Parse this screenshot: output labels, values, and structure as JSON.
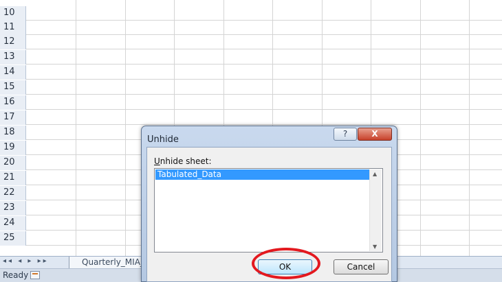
{
  "grid": {
    "rows": [
      "10",
      "11",
      "12",
      "13",
      "14",
      "15",
      "16",
      "17",
      "18",
      "19",
      "20",
      "21",
      "22",
      "23",
      "24",
      "25"
    ]
  },
  "tabbar": {
    "nav_icons": "first-prev-next-last-sheet-icons",
    "sheet_tab": "Quarterly_MIA_Da"
  },
  "status": {
    "ready": "Ready",
    "macro_icon": "macro-record-icon"
  },
  "dialog": {
    "title": "Unhide",
    "help": "?",
    "close": "X",
    "label_access": "U",
    "label_rest": "nhide sheet:",
    "list_items": [
      "Tabulated_Data"
    ],
    "ok": "OK",
    "cancel": "Cancel"
  },
  "colors": {
    "selection": "#3399ff",
    "close_button": "#c7412a",
    "highlight_circle": "#e3191f"
  }
}
